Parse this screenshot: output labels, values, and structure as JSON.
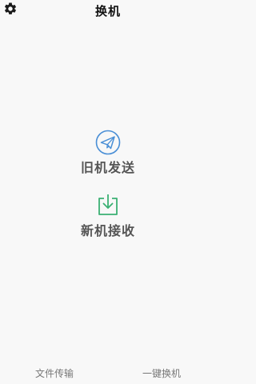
{
  "header": {
    "title": "换机",
    "settings_icon": "gear-icon"
  },
  "actions": {
    "send_old": {
      "label": "旧机发送",
      "icon": "paper-plane-icon",
      "icon_color": "#4a8fd6"
    },
    "receive_new": {
      "label": "新机接收",
      "icon": "download-tray-icon",
      "icon_color": "#3bb073"
    }
  },
  "bottom_nav": {
    "items": [
      {
        "label": "文件传输"
      },
      {
        "label": "一键换机"
      }
    ]
  },
  "colors": {
    "background": "#f8f8f8",
    "title_text": "#111111",
    "action_text": "#555555",
    "nav_text": "#777777"
  }
}
